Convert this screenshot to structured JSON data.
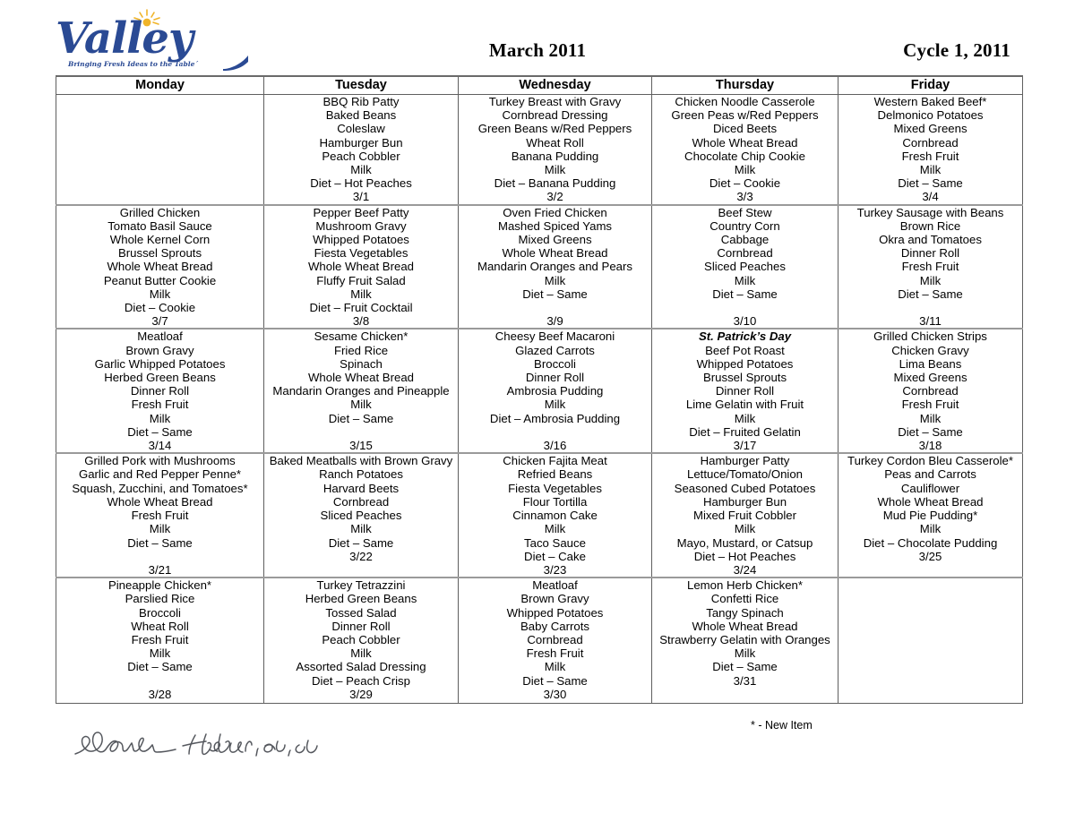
{
  "header": {
    "logo_word": "Valley",
    "logo_tagline": "Bringing Fresh Ideas to the Table´",
    "logo_color": "#2a4a94",
    "sun_color": "#f0b429",
    "month_title": "March 2011",
    "cycle_title": "Cycle 1, 2011"
  },
  "calendar": {
    "columns": [
      "Monday",
      "Tuesday",
      "Wednesday",
      "Thursday",
      "Friday"
    ],
    "weeks": [
      {
        "days": [
          {
            "items": [],
            "date": ""
          },
          {
            "items": [
              "BBQ Rib Patty",
              "Baked Beans",
              "Coleslaw",
              "Hamburger Bun",
              "Peach Cobbler",
              "Milk",
              "Diet – Hot Peaches"
            ],
            "date": "3/1"
          },
          {
            "items": [
              "Turkey Breast with Gravy",
              "Cornbread Dressing",
              "Green Beans w/Red Peppers",
              "Wheat Roll",
              "Banana Pudding",
              "Milk",
              "Diet – Banana Pudding"
            ],
            "date": "3/2"
          },
          {
            "items": [
              "Chicken Noodle Casserole",
              "Green Peas w/Red Peppers",
              "Diced Beets",
              "Whole Wheat Bread",
              "Chocolate Chip Cookie",
              "Milk",
              "Diet – Cookie"
            ],
            "date": "3/3"
          },
          {
            "items": [
              "Western Baked Beef*",
              "Delmonico Potatoes",
              "Mixed Greens",
              "Cornbread",
              "Fresh Fruit",
              "Milk",
              "Diet – Same"
            ],
            "date": "3/4"
          }
        ]
      },
      {
        "days": [
          {
            "items": [
              "Grilled Chicken",
              "Tomato Basil Sauce",
              "Whole Kernel Corn",
              "Brussel Sprouts",
              "Whole Wheat Bread",
              "Peanut Butter Cookie",
              "Milk",
              "Diet – Cookie"
            ],
            "date": "3/7"
          },
          {
            "items": [
              "Pepper Beef Patty",
              "Mushroom Gravy",
              "Whipped Potatoes",
              "Fiesta Vegetables",
              "Whole Wheat Bread",
              "Fluffy Fruit Salad",
              "Milk",
              "Diet – Fruit Cocktail"
            ],
            "date": "3/8"
          },
          {
            "items": [
              "Oven Fried Chicken",
              "Mashed Spiced Yams",
              "Mixed Greens",
              "Whole Wheat Bread",
              "Mandarin Oranges and Pears",
              "Milk",
              "Diet – Same",
              ""
            ],
            "date": "3/9"
          },
          {
            "items": [
              "Beef Stew",
              "Country Corn",
              "Cabbage",
              "Cornbread",
              "Sliced Peaches",
              "Milk",
              "Diet – Same",
              ""
            ],
            "date": "3/10"
          },
          {
            "items": [
              "Turkey Sausage with Beans",
              "Brown Rice",
              "Okra and Tomatoes",
              "Dinner Roll",
              "Fresh Fruit",
              "Milk",
              "Diet – Same",
              ""
            ],
            "date": "3/11"
          }
        ]
      },
      {
        "days": [
          {
            "items": [
              "Meatloaf",
              "Brown Gravy",
              "Garlic Whipped Potatoes",
              "Herbed Green Beans",
              "Dinner Roll",
              "Fresh Fruit",
              "Milk",
              "Diet – Same"
            ],
            "date": "3/14"
          },
          {
            "items": [
              "Sesame Chicken*",
              "Fried Rice",
              "Spinach",
              "Whole Wheat Bread",
              "Mandarin Oranges and Pineapple",
              "Milk",
              "Diet – Same",
              ""
            ],
            "date": "3/15"
          },
          {
            "items": [
              "Cheesy Beef Macaroni",
              "Glazed Carrots",
              "Broccoli",
              "Dinner Roll",
              "Ambrosia Pudding",
              "Milk",
              "Diet – Ambrosia Pudding",
              ""
            ],
            "date": "3/16"
          },
          {
            "items": [
              "St. Patrick’s Day",
              "Beef Pot Roast",
              "Whipped Potatoes",
              "Brussel Sprouts",
              "Dinner Roll",
              "Lime Gelatin with Fruit",
              "Milk",
              "Diet – Fruited Gelatin"
            ],
            "holiday_index": 0,
            "date": "3/17"
          },
          {
            "items": [
              "Grilled Chicken Strips",
              "Chicken Gravy",
              "Lima Beans",
              "Mixed Greens",
              "Cornbread",
              "Fresh Fruit",
              "Milk",
              "Diet – Same"
            ],
            "date": "3/18"
          }
        ]
      },
      {
        "days": [
          {
            "items": [
              "Grilled Pork with Mushrooms",
              "Garlic and Red Pepper Penne*",
              "Squash, Zucchini, and Tomatoes*",
              "Whole Wheat Bread",
              "Fresh Fruit",
              "Milk",
              "Diet – Same",
              ""
            ],
            "date": "3/21"
          },
          {
            "items": [
              "Baked Meatballs with Brown Gravy",
              "Ranch Potatoes",
              "Harvard Beets",
              "Cornbread",
              "Sliced Peaches",
              "Milk",
              "Diet – Same"
            ],
            "date": "3/22"
          },
          {
            "items": [
              "Chicken Fajita Meat",
              "Refried Beans",
              "Fiesta Vegetables",
              "Flour Tortilla",
              "Cinnamon Cake",
              "Milk",
              "Taco Sauce",
              "Diet – Cake"
            ],
            "date": "3/23"
          },
          {
            "items": [
              "Hamburger Patty",
              "Lettuce/Tomato/Onion",
              "Seasoned Cubed Potatoes",
              "Hamburger Bun",
              "Mixed Fruit Cobbler",
              "Milk",
              "Mayo, Mustard, or Catsup",
              "Diet – Hot Peaches"
            ],
            "date": "3/24"
          },
          {
            "items": [
              "Turkey Cordon Bleu Casserole*",
              "Peas and Carrots",
              "Cauliflower",
              "Whole Wheat Bread",
              "Mud Pie Pudding*",
              "Milk",
              "Diet – Chocolate Pudding"
            ],
            "date": "3/25"
          }
        ]
      },
      {
        "days": [
          {
            "items": [
              "Pineapple Chicken*",
              "Parslied Rice",
              "Broccoli",
              "Wheat Roll",
              "Fresh Fruit",
              "Milk",
              "Diet – Same",
              ""
            ],
            "date": "3/28"
          },
          {
            "items": [
              "Turkey Tetrazzini",
              "Herbed Green Beans",
              "Tossed Salad",
              "Dinner Roll",
              "Peach Cobbler",
              "Milk",
              "Assorted Salad Dressing",
              "Diet – Peach Crisp"
            ],
            "date": "3/29"
          },
          {
            "items": [
              "Meatloaf",
              "Brown Gravy",
              "Whipped Potatoes",
              "Baby Carrots",
              "Cornbread",
              "Fresh Fruit",
              "Milk",
              "Diet – Same"
            ],
            "date": "3/30"
          },
          {
            "items": [
              "Lemon Herb Chicken*",
              "Confetti Rice",
              "Tangy Spinach",
              "Whole Wheat Bread",
              "Strawberry Gelatin with Oranges",
              "Milk",
              "Diet – Same"
            ],
            "date": "3/31"
          },
          {
            "items": [],
            "date": "",
            "no_border": true
          }
        ]
      }
    ]
  },
  "footer": {
    "footnote": "* - New Item",
    "signature_text": "Sarah Hutsler, RD, LD"
  }
}
